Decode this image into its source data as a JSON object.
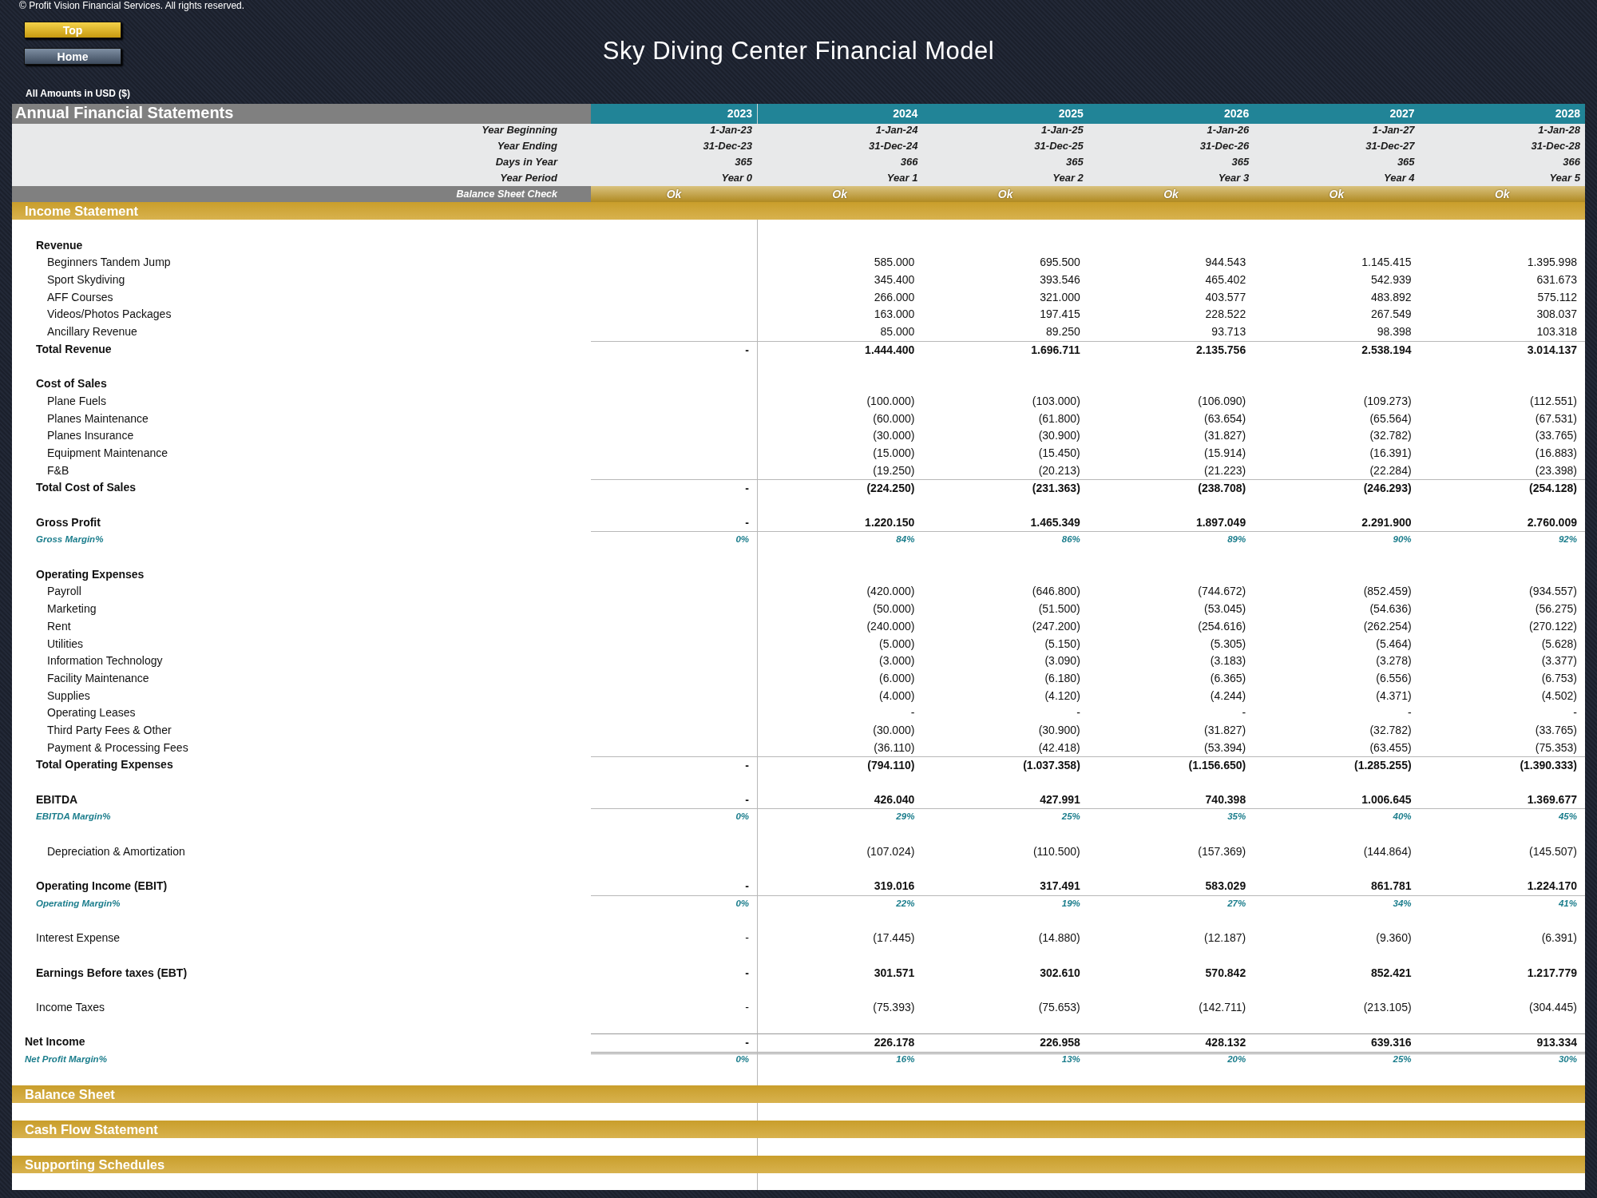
{
  "header": {
    "copyright": "© Profit Vision Financial Services. All rights reserved.",
    "buttons": [
      {
        "label": "Top",
        "kind": "gold"
      },
      {
        "label": "Home",
        "kind": "slate"
      }
    ],
    "title": "Sky Diving Center Financial Model",
    "amounts_note": "All Amounts in  USD ($)"
  },
  "table": {
    "title": "Annual Financial Statements",
    "years": [
      "2023",
      "2024",
      "2025",
      "2026",
      "2027",
      "2028"
    ],
    "info_rows": [
      {
        "label": "Year Beginning",
        "values": [
          "1-Jan-23",
          "1-Jan-24",
          "1-Jan-25",
          "1-Jan-26",
          "1-Jan-27",
          "1-Jan-28"
        ]
      },
      {
        "label": "Year Ending",
        "values": [
          "31-Dec-23",
          "31-Dec-24",
          "31-Dec-25",
          "31-Dec-26",
          "31-Dec-27",
          "31-Dec-28"
        ]
      },
      {
        "label": "Days in Year",
        "values": [
          "365",
          "366",
          "365",
          "365",
          "365",
          "366"
        ]
      },
      {
        "label": "Year Period",
        "values": [
          "Year 0",
          "Year 1",
          "Year 2",
          "Year 3",
          "Year 4",
          "Year 5"
        ]
      }
    ],
    "check": {
      "label": "Balance Sheet Check",
      "values": [
        "Ok",
        "Ok",
        "Ok",
        "Ok",
        "Ok",
        "Ok"
      ]
    },
    "sections": [
      {
        "title": "Income Statement",
        "rows": [
          {
            "kind": "blank"
          },
          {
            "kind": "heading",
            "label": "Revenue"
          },
          {
            "kind": "item",
            "label": "Beginners Tandem Jump",
            "values": [
              "585.000",
              "695.500",
              "944.543",
              "1.145.415",
              "1.395.998"
            ]
          },
          {
            "kind": "item",
            "label": "Sport Skydiving",
            "values": [
              "345.400",
              "393.546",
              "465.402",
              "542.939",
              "631.673"
            ]
          },
          {
            "kind": "item",
            "label": "AFF Courses",
            "values": [
              "266.000",
              "321.000",
              "403.577",
              "483.892",
              "575.112"
            ]
          },
          {
            "kind": "item",
            "label": "Videos/Photos Packages",
            "values": [
              "163.000",
              "197.415",
              "228.522",
              "267.549",
              "308.037"
            ]
          },
          {
            "kind": "item",
            "label": "Ancillary Revenue",
            "values": [
              "85.000",
              "89.250",
              "93.713",
              "98.398",
              "103.318"
            ]
          },
          {
            "kind": "total",
            "label": "Total Revenue",
            "base": "-",
            "values": [
              "1.444.400",
              "1.696.711",
              "2.135.756",
              "2.538.194",
              "3.014.137"
            ]
          },
          {
            "kind": "blank"
          },
          {
            "kind": "heading",
            "label": "Cost of Sales"
          },
          {
            "kind": "item",
            "label": "Plane Fuels",
            "values": [
              "(100.000)",
              "(103.000)",
              "(106.090)",
              "(109.273)",
              "(112.551)"
            ]
          },
          {
            "kind": "item",
            "label": "Planes Maintenance",
            "values": [
              "(60.000)",
              "(61.800)",
              "(63.654)",
              "(65.564)",
              "(67.531)"
            ]
          },
          {
            "kind": "item",
            "label": "Planes Insurance",
            "values": [
              "(30.000)",
              "(30.900)",
              "(31.827)",
              "(32.782)",
              "(33.765)"
            ]
          },
          {
            "kind": "item",
            "label": "Equipment Maintenance",
            "values": [
              "(15.000)",
              "(15.450)",
              "(15.914)",
              "(16.391)",
              "(16.883)"
            ]
          },
          {
            "kind": "item",
            "label": "F&B",
            "values": [
              "(19.250)",
              "(20.213)",
              "(21.223)",
              "(22.284)",
              "(23.398)"
            ]
          },
          {
            "kind": "total",
            "label": "Total Cost of Sales",
            "base": "-",
            "values": [
              "(224.250)",
              "(231.363)",
              "(238.708)",
              "(246.293)",
              "(254.128)"
            ]
          },
          {
            "kind": "blank"
          },
          {
            "kind": "profit",
            "label": "Gross Profit",
            "base": "-",
            "values": [
              "1.220.150",
              "1.465.349",
              "1.897.049",
              "2.291.900",
              "2.760.009"
            ]
          },
          {
            "kind": "margin",
            "label": "Gross Margin%",
            "base": "0%",
            "values": [
              "84%",
              "86%",
              "89%",
              "90%",
              "92%"
            ]
          },
          {
            "kind": "blank"
          },
          {
            "kind": "heading",
            "label": "Operating Expenses"
          },
          {
            "kind": "item",
            "label": "Payroll",
            "values": [
              "(420.000)",
              "(646.800)",
              "(744.672)",
              "(852.459)",
              "(934.557)"
            ]
          },
          {
            "kind": "item",
            "label": "Marketing",
            "values": [
              "(50.000)",
              "(51.500)",
              "(53.045)",
              "(54.636)",
              "(56.275)"
            ]
          },
          {
            "kind": "item",
            "label": "Rent",
            "values": [
              "(240.000)",
              "(247.200)",
              "(254.616)",
              "(262.254)",
              "(270.122)"
            ]
          },
          {
            "kind": "item",
            "label": "Utilities",
            "values": [
              "(5.000)",
              "(5.150)",
              "(5.305)",
              "(5.464)",
              "(5.628)"
            ]
          },
          {
            "kind": "item",
            "label": "Information Technology",
            "values": [
              "(3.000)",
              "(3.090)",
              "(3.183)",
              "(3.278)",
              "(3.377)"
            ]
          },
          {
            "kind": "item",
            "label": "Facility Maintenance",
            "values": [
              "(6.000)",
              "(6.180)",
              "(6.365)",
              "(6.556)",
              "(6.753)"
            ]
          },
          {
            "kind": "item",
            "label": "Supplies",
            "values": [
              "(4.000)",
              "(4.120)",
              "(4.244)",
              "(4.371)",
              "(4.502)"
            ]
          },
          {
            "kind": "item",
            "label": "Operating Leases",
            "values": [
              "-",
              "-",
              "-",
              "-",
              "-"
            ]
          },
          {
            "kind": "item",
            "label": "Third Party Fees & Other",
            "values": [
              "(30.000)",
              "(30.900)",
              "(31.827)",
              "(32.782)",
              "(33.765)"
            ]
          },
          {
            "kind": "item",
            "label": "Payment & Processing Fees",
            "values": [
              "(36.110)",
              "(42.418)",
              "(53.394)",
              "(63.455)",
              "(75.353)"
            ]
          },
          {
            "kind": "total",
            "label": "Total Operating Expenses",
            "base": "-",
            "values": [
              "(794.110)",
              "(1.037.358)",
              "(1.156.650)",
              "(1.285.255)",
              "(1.390.333)"
            ]
          },
          {
            "kind": "blank"
          },
          {
            "kind": "profit",
            "label": "EBITDA",
            "base": "-",
            "values": [
              "426.040",
              "427.991",
              "740.398",
              "1.006.645",
              "1.369.677"
            ]
          },
          {
            "kind": "margin",
            "label": "EBITDA Margin%",
            "base": "0%",
            "values": [
              "29%",
              "25%",
              "35%",
              "40%",
              "45%"
            ]
          },
          {
            "kind": "blank"
          },
          {
            "kind": "item",
            "label": "Depreciation & Amortization",
            "values": [
              "(107.024)",
              "(110.500)",
              "(157.369)",
              "(144.864)",
              "(145.507)"
            ]
          },
          {
            "kind": "blank"
          },
          {
            "kind": "profit",
            "label": "Operating Income (EBIT)",
            "base": "-",
            "values": [
              "319.016",
              "317.491",
              "583.029",
              "861.781",
              "1.224.170"
            ]
          },
          {
            "kind": "margin",
            "label": "Operating Margin%",
            "base": "0%",
            "values": [
              "22%",
              "19%",
              "27%",
              "34%",
              "41%"
            ]
          },
          {
            "kind": "blank"
          },
          {
            "kind": "line",
            "label": "Interest Expense",
            "base": "-",
            "values": [
              "(17.445)",
              "(14.880)",
              "(12.187)",
              "(9.360)",
              "(6.391)"
            ]
          },
          {
            "kind": "blank"
          },
          {
            "kind": "bold",
            "label": "Earnings Before taxes (EBT)",
            "base": "-",
            "values": [
              "301.571",
              "302.610",
              "570.842",
              "852.421",
              "1.217.779"
            ]
          },
          {
            "kind": "blank"
          },
          {
            "kind": "line",
            "label": "Income Taxes",
            "base": "-",
            "values": [
              "(75.393)",
              "(75.653)",
              "(142.711)",
              "(213.105)",
              "(304.445)"
            ]
          },
          {
            "kind": "blank"
          },
          {
            "kind": "net",
            "label": "Net Income",
            "base": "-",
            "values": [
              "226.178",
              "226.958",
              "428.132",
              "639.316",
              "913.334"
            ]
          },
          {
            "kind": "netmargin",
            "label": "Net Profit Margin%",
            "base": "0%",
            "values": [
              "16%",
              "13%",
              "20%",
              "25%",
              "30%"
            ]
          },
          {
            "kind": "blank"
          }
        ]
      },
      {
        "title": "Balance Sheet"
      },
      {
        "title": "Cash Flow Statement"
      },
      {
        "title": "Supporting Schedules"
      }
    ]
  }
}
